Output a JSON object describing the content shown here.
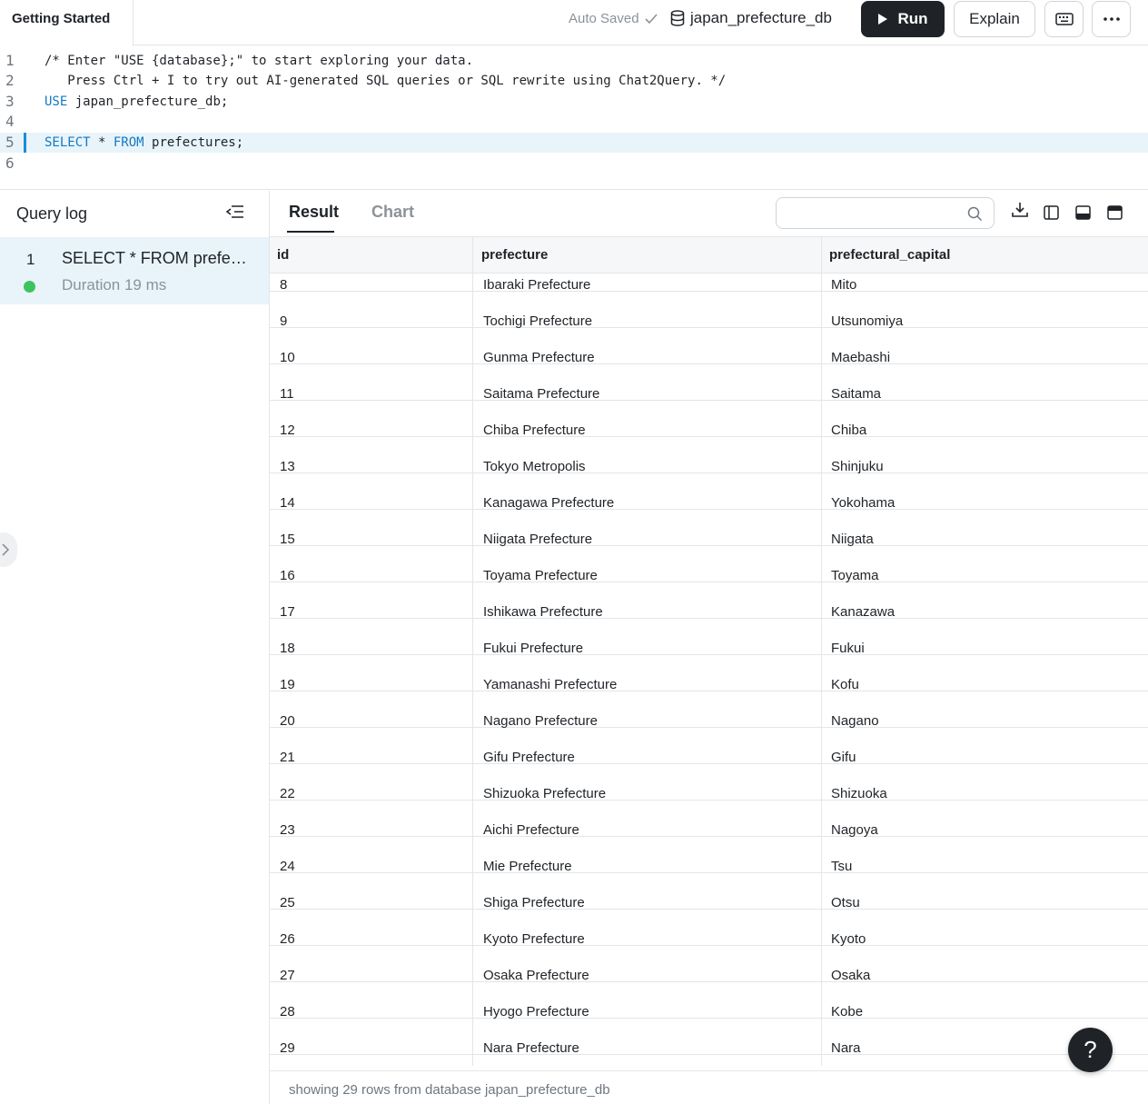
{
  "header": {
    "tab_title": "Getting Started",
    "autosave_label": "Auto Saved",
    "database_name": "japan_prefecture_db",
    "run_label": "Run",
    "explain_label": "Explain"
  },
  "editor": {
    "lines": [
      {
        "num": "1",
        "text": "/* Enter \"USE {database};\" to start exploring your data."
      },
      {
        "num": "2",
        "text": "   Press Ctrl + I to try out AI-generated SQL queries or SQL rewrite using Chat2Query. */"
      },
      {
        "num": "3",
        "kw": "USE",
        "text": " japan_prefecture_db;"
      },
      {
        "num": "4",
        "text": ""
      },
      {
        "num": "5",
        "kw": "SELECT",
        "mid": " * ",
        "kw2": "FROM",
        "text": " prefectures;"
      },
      {
        "num": "6",
        "text": ""
      }
    ]
  },
  "query_log": {
    "title": "Query log",
    "items": [
      {
        "num": "1",
        "query": "SELECT * FROM prefectures;",
        "duration": "Duration 19 ms",
        "status": "success"
      }
    ]
  },
  "result": {
    "tabs": [
      "Result",
      "Chart"
    ],
    "active_tab": "Result",
    "search_placeholder": "",
    "columns": [
      "id",
      "prefecture",
      "prefectural_capital"
    ],
    "rows": [
      [
        "8",
        "Ibaraki Prefecture",
        "Mito"
      ],
      [
        "9",
        "Tochigi Prefecture",
        "Utsunomiya"
      ],
      [
        "10",
        "Gunma Prefecture",
        "Maebashi"
      ],
      [
        "11",
        "Saitama Prefecture",
        "Saitama"
      ],
      [
        "12",
        "Chiba Prefecture",
        "Chiba"
      ],
      [
        "13",
        "Tokyo Metropolis",
        "Shinjuku"
      ],
      [
        "14",
        "Kanagawa Prefecture",
        "Yokohama"
      ],
      [
        "15",
        "Niigata Prefecture",
        "Niigata"
      ],
      [
        "16",
        "Toyama Prefecture",
        "Toyama"
      ],
      [
        "17",
        "Ishikawa Prefecture",
        "Kanazawa"
      ],
      [
        "18",
        "Fukui Prefecture",
        "Fukui"
      ],
      [
        "19",
        "Yamanashi Prefecture",
        "Kofu"
      ],
      [
        "20",
        "Nagano Prefecture",
        "Nagano"
      ],
      [
        "21",
        "Gifu Prefecture",
        "Gifu"
      ],
      [
        "22",
        "Shizuoka Prefecture",
        "Shizuoka"
      ],
      [
        "23",
        "Aichi Prefecture",
        "Nagoya"
      ],
      [
        "24",
        "Mie Prefecture",
        "Tsu"
      ],
      [
        "25",
        "Shiga Prefecture",
        "Otsu"
      ],
      [
        "26",
        "Kyoto Prefecture",
        "Kyoto"
      ],
      [
        "27",
        "Osaka Prefecture",
        "Osaka"
      ],
      [
        "28",
        "Hyogo Prefecture",
        "Kobe"
      ],
      [
        "29",
        "Nara Prefecture",
        "Nara"
      ]
    ],
    "footer": "showing 29 rows from database japan_prefecture_db"
  },
  "help_label": "?",
  "colors": {
    "accent_dark": "#1f2328",
    "active_line": "#e8f4fa",
    "keyword": "#1479c4",
    "comment": "#20a050",
    "success": "#3dc45e"
  },
  "icons": [
    "check-icon",
    "database-icon",
    "play-icon",
    "keyboard-icon",
    "more-icon",
    "collapse-icon",
    "search-icon",
    "download-icon",
    "split-left-icon",
    "split-bottom-icon",
    "split-top-icon",
    "chevron-right-icon"
  ]
}
